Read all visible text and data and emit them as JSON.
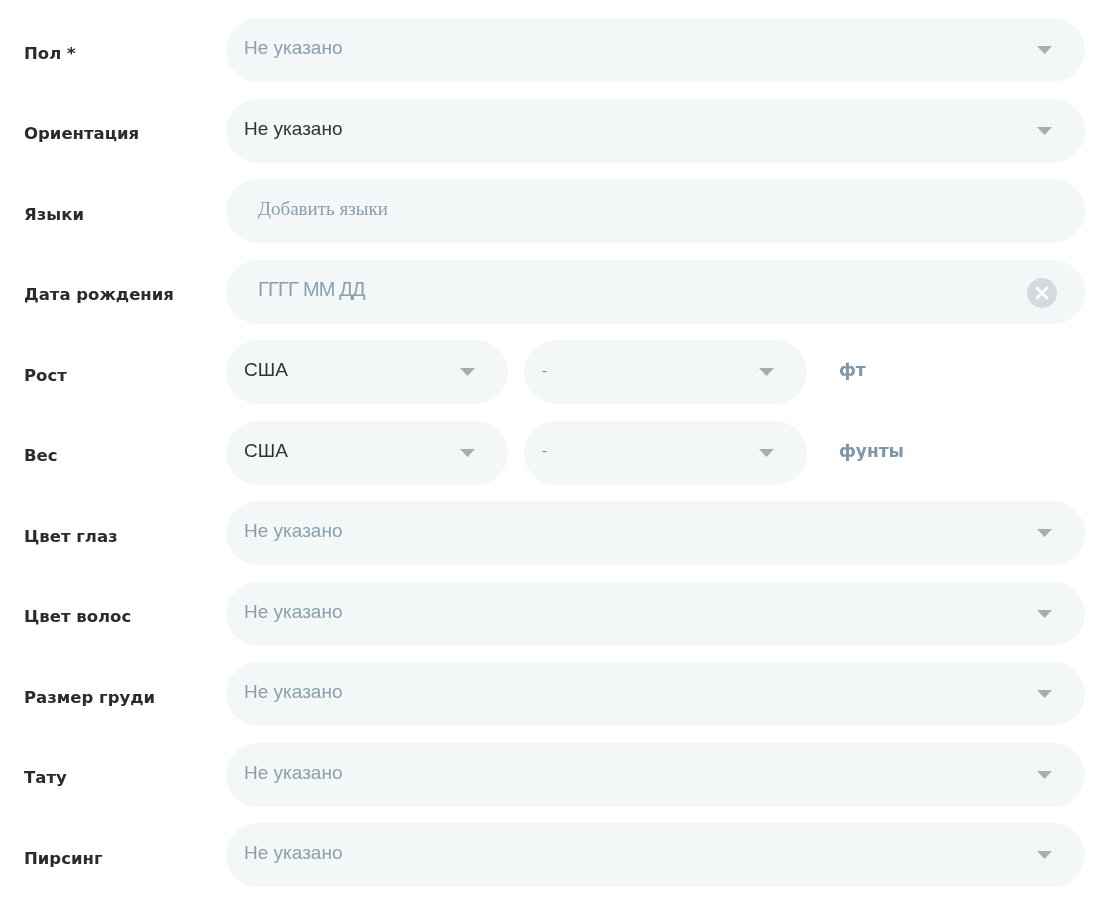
{
  "fields": [
    {
      "kind": "select",
      "label": "Пол *",
      "placeholder": "Не указано"
    },
    {
      "kind": "select",
      "label": "Ориентация",
      "value": "Не указано"
    },
    {
      "kind": "text",
      "label": "Языки",
      "placeholder": "Добавить языки"
    },
    {
      "kind": "date",
      "label": "Дата рождения",
      "placeholder": "ГГГГ ММ ДД"
    },
    {
      "kind": "measure",
      "label": "Рост",
      "system": {
        "value": "США"
      },
      "amount": {
        "placeholder": "-"
      },
      "unit": "фт"
    },
    {
      "kind": "measure",
      "label": "Вес",
      "system": {
        "value": "США"
      },
      "amount": {
        "placeholder": "-"
      },
      "unit": "фунты"
    },
    {
      "kind": "select",
      "label": "Цвет глаз",
      "placeholder": "Не указано"
    },
    {
      "kind": "select",
      "label": "Цвет волос",
      "placeholder": "Не указано"
    },
    {
      "kind": "select",
      "label": "Размер груди",
      "placeholder": "Не указано"
    },
    {
      "kind": "select",
      "label": "Тату",
      "placeholder": "Не указано"
    },
    {
      "kind": "select",
      "label": "Пирсинг",
      "placeholder": "Не указано"
    }
  ]
}
